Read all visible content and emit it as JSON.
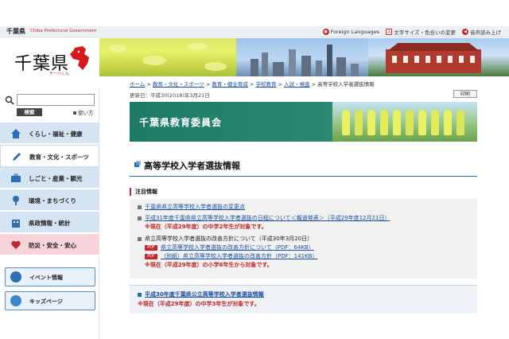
{
  "topbar": {
    "brand": "千葉県",
    "brand_sub": "Chiba Prefectural Government",
    "links": [
      {
        "icon": "globe-icon",
        "label": "Foreign Languages"
      },
      {
        "icon": "text-size-icon",
        "label": "文字サイズ・色合いの変更"
      },
      {
        "icon": "speaker-icon",
        "label": "音声読み上げ"
      }
    ]
  },
  "sidebar": {
    "logo": "千葉県",
    "logo_sub": "チーバくん",
    "search_button": "検索",
    "usage_link": "使い方",
    "nav": [
      {
        "label": "くらし・福祉・健康",
        "icon": "house-icon"
      },
      {
        "label": "教育・文化・スポーツ",
        "icon": "pencil-icon"
      },
      {
        "label": "しごと・産業・観光",
        "icon": "briefcase-icon"
      },
      {
        "label": "環境・まちづくり",
        "icon": "tree-icon"
      },
      {
        "label": "県政情報・統計",
        "icon": "building-icon"
      },
      {
        "label": "防災・安全・安心",
        "icon": "heart-icon"
      }
    ],
    "quick": [
      {
        "label": "イベント情報",
        "icon": "calendar-icon"
      },
      {
        "label": "キッズページ",
        "icon": "kids-icon"
      }
    ]
  },
  "main": {
    "breadcrumb": [
      "ホーム",
      "教育・文化・スポーツ",
      "教育・健全育成",
      "学校教育",
      "入試・検査",
      "高等学校入学者選抜情報"
    ],
    "breadcrumb_sep": " > ",
    "updated": "更新日：平成30(2018)年3月21日",
    "print": "印刷",
    "hero_title": "千葉県教育委員会",
    "page_title": "高等学校入学者選抜情報",
    "notice_heading": "注目情報",
    "items": {
      "i1": "千葉県県立高等学校入学者選抜の変更点",
      "i2_link": "平成31年度千葉県県立高等学校入学者選抜の日程について＜報道発表＞（平成29年度12月21日）",
      "i2_note": "※現在（平成29年度）の中学2年生が対象です。",
      "i3_title": "県立高等学校入学者選抜の改善方針について",
      "i3_date": "（平成30年3月20日）",
      "pdf_label": "PDF",
      "i3_pdf1": "県立高等学校入学者選抜の改善方針について（PDF：64KB）",
      "i3_pdf2": "（別紙）県立高等学校入学者選抜の改善方針（PDF：141KB）",
      "i3_note": "※現在（平成29年度）の小学6年生から対象です。",
      "i4_link": "平成30年度千葉県公立高等学校入学者選抜情報",
      "i4_note": "※現在（平成29年度）の中学3年生が対象です。"
    }
  },
  "colors": {
    "accent": "#1d6fb1",
    "brand_red": "#c1272d",
    "hero_green": "#1d7a68"
  }
}
